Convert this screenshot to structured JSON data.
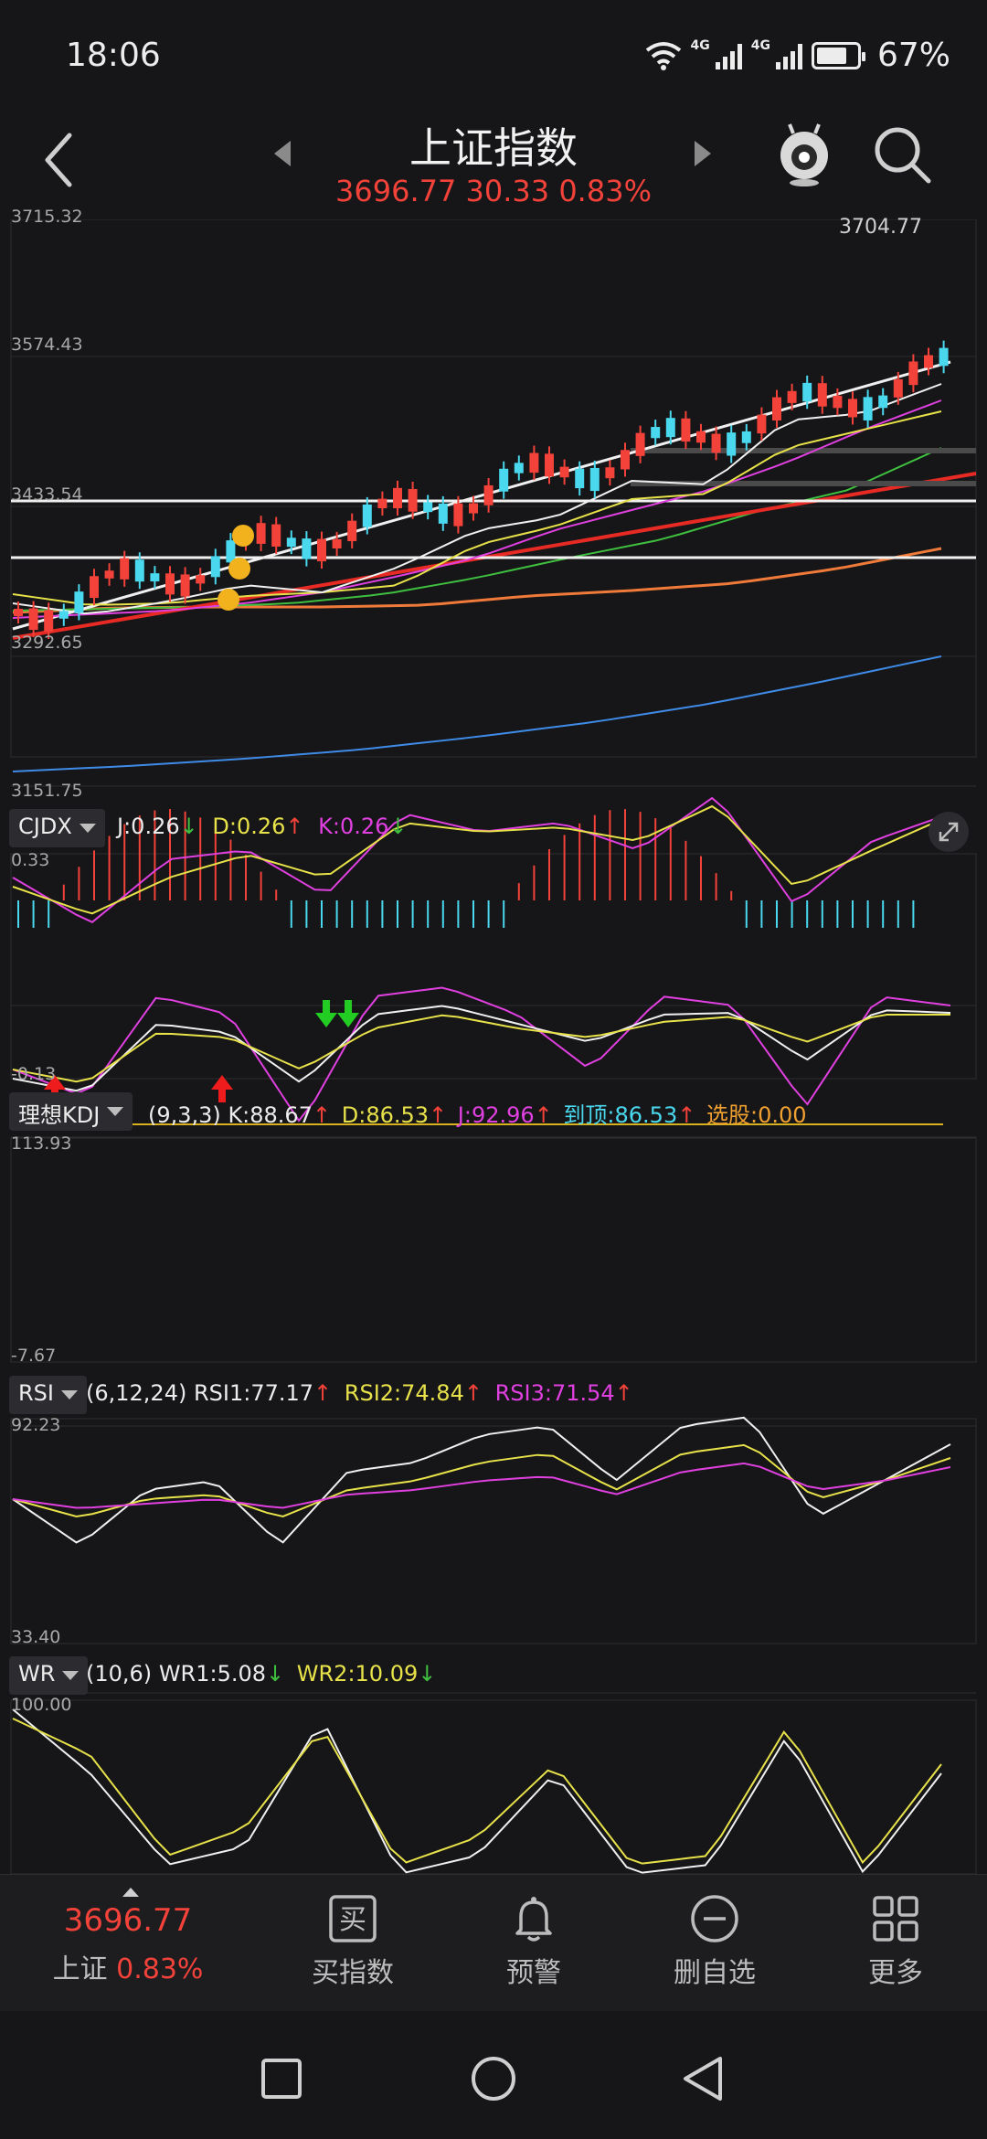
{
  "status": {
    "time": "18:06",
    "network1": "4G",
    "network2": "4G",
    "battery": "67%"
  },
  "header": {
    "title": "上证指数",
    "quote": "3696.77 30.33 0.83%"
  },
  "main_chart": {
    "price_labels": [
      "3715.32",
      "3574.43",
      "3433.54",
      "3292.65",
      "3151.75"
    ],
    "high_label": "3704.77"
  },
  "cjdx": {
    "name": "CJDX",
    "j_label": "J:",
    "j_value": "0.26",
    "j_arrow": "↓",
    "d_label": "D:",
    "d_value": "0.26",
    "d_arrow": "↑",
    "k_label": "K:",
    "k_value": "0.26",
    "k_arrow": "↓",
    "top": "0.33",
    "bottom": "-0.13"
  },
  "kdj": {
    "name": "理想KDJ",
    "params": "(9,3,3)",
    "k_label": "K:",
    "k_value": "88.67",
    "k_arrow": "↑",
    "d_label": "D:",
    "d_value": "86.53",
    "d_arrow": "↑",
    "j_label": "J:",
    "j_value": "92.96",
    "j_arrow": "↑",
    "top_label": "到顶:",
    "top_value": "86.53",
    "top_arrow": "↑",
    "pick_label": "选股:",
    "pick_value": "0.00",
    "axis_top": "113.93",
    "axis_bottom": "-7.67"
  },
  "rsi": {
    "name": "RSI",
    "params": "(6,12,24)",
    "rsi1_label": "RSI1:",
    "rsi1_value": "77.17",
    "rsi1_arrow": "↑",
    "rsi2_label": "RSI2:",
    "rsi2_value": "74.84",
    "rsi2_arrow": "↑",
    "rsi3_label": "RSI3:",
    "rsi3_value": "71.54",
    "rsi3_arrow": "↑",
    "axis_top": "92.23",
    "axis_bottom": "33.40"
  },
  "wr": {
    "name": "WR",
    "params": "(10,6)",
    "wr1_label": "WR1:",
    "wr1_value": "5.08",
    "wr1_arrow": "↓",
    "wr2_label": "WR2:",
    "wr2_value": "10.09",
    "wr2_arrow": "↓",
    "axis_top": "100.00"
  },
  "bottom_bar": {
    "index_value": "3696.77",
    "index_name": "上证",
    "index_change": "0.83%",
    "buy_icon_char": "买",
    "buy_label": "买指数",
    "alert_label": "预警",
    "remove_label": "删自选",
    "more_label": "更多"
  },
  "colors": {
    "up": "#f2423a",
    "down": "#49d8ee",
    "yellow": "#e8e24a",
    "magenta": "#e040e0",
    "green": "#3fbf3f",
    "orange": "#f07a3a",
    "blue": "#3f8be8"
  }
}
